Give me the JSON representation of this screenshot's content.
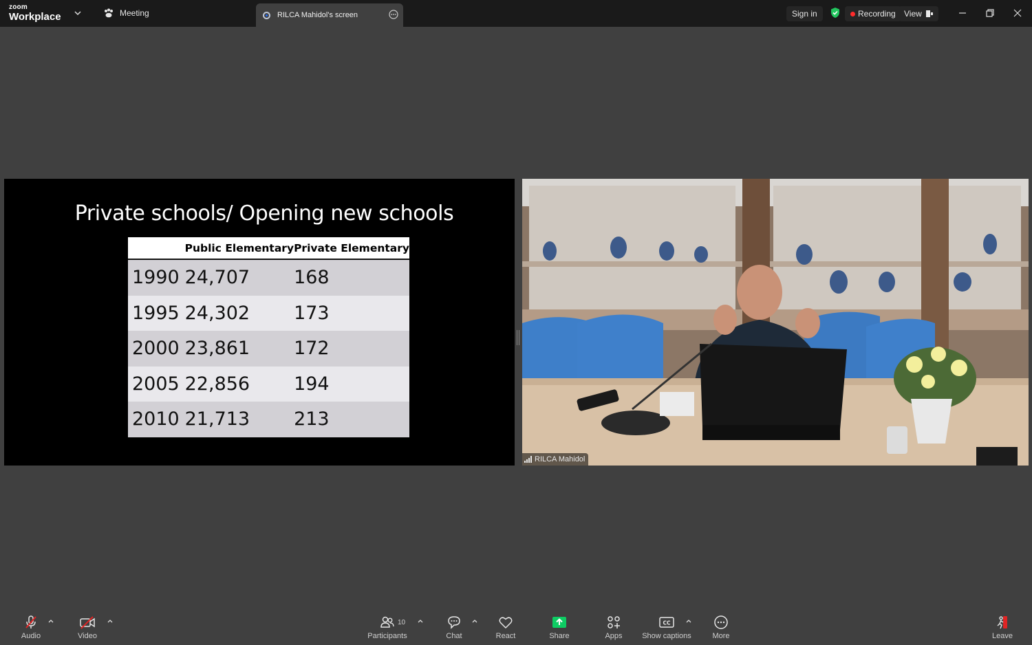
{
  "app": {
    "brand_small": "zoom",
    "brand_large": "Workplace",
    "meeting_tab": "Meeting",
    "screen_tab": "RILCA Mahidol's screen",
    "sign_in": "Sign in",
    "recording": "Recording",
    "view": "View"
  },
  "slide": {
    "title": "Private schools/ Opening new schools",
    "headers": [
      "",
      "Public Elementary",
      "Private Elementary"
    ],
    "rows": [
      [
        "1990",
        "24,707",
        "168"
      ],
      [
        "1995",
        "24,302",
        "173"
      ],
      [
        "2000",
        "23,861",
        "172"
      ],
      [
        "2005",
        "22,856",
        "194"
      ],
      [
        "2010",
        "21,713",
        "213"
      ]
    ]
  },
  "video": {
    "participant_name": "RILCA Mahidol"
  },
  "toolbar": {
    "audio": "Audio",
    "video": "Video",
    "participants": "Participants",
    "participants_count": "10",
    "chat": "Chat",
    "react": "React",
    "share": "Share",
    "apps": "Apps",
    "captions": "Show captions",
    "more": "More",
    "leave": "Leave"
  },
  "colors": {
    "accent_share": "#0ecc63",
    "recording_dot": "#ff2b2b",
    "shield": "#22c55e",
    "muted_red": "#e02424"
  }
}
